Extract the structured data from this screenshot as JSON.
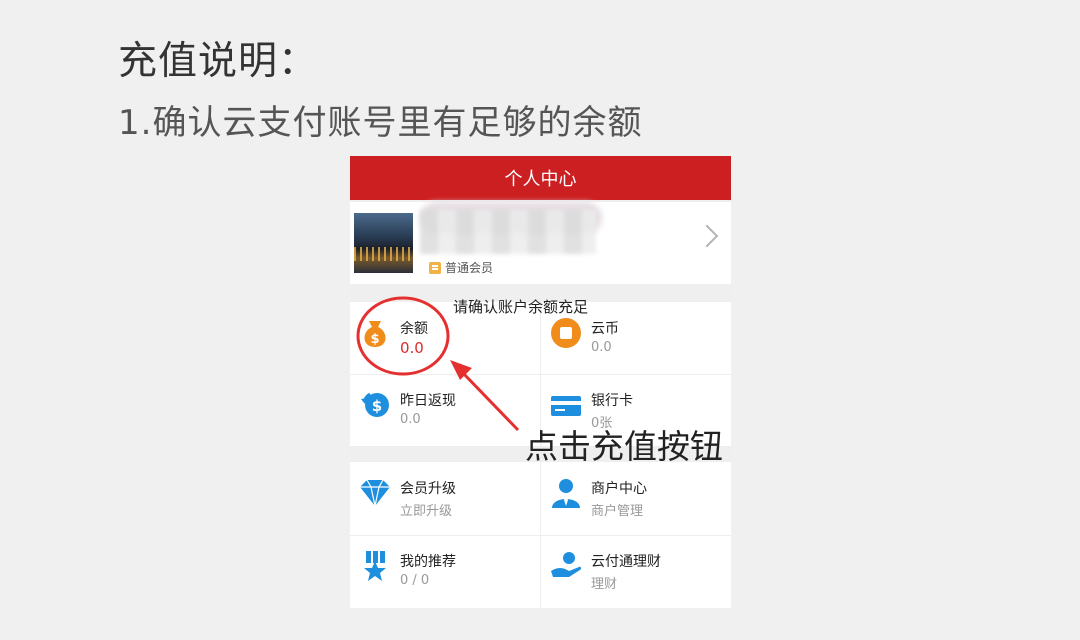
{
  "slide": {
    "heading": "充值说明：",
    "subheading": "1.确认云支付账号里有足够的余额"
  },
  "app": {
    "title": "个人中心",
    "profile": {
      "member_level": "普通会员"
    },
    "grid_top": [
      {
        "title": "余额",
        "value": "0.0",
        "icon": "money-bag-icon"
      },
      {
        "title": "云币",
        "value": "0.0",
        "icon": "coin-icon"
      },
      {
        "title": "昨日返现",
        "value": "0.0",
        "icon": "cashback-icon"
      },
      {
        "title": "银行卡",
        "value": "0张",
        "icon": "bank-card-icon"
      }
    ],
    "grid_bottom": [
      {
        "title": "会员升级",
        "value": "立即升级",
        "icon": "diamond-icon"
      },
      {
        "title": "商户中心",
        "value": "商户管理",
        "icon": "merchant-icon"
      },
      {
        "title": "我的推荐",
        "value": "0 / 0",
        "icon": "medal-icon"
      },
      {
        "title": "云付通理财",
        "value": "理财",
        "icon": "finance-icon"
      }
    ]
  },
  "annotations": {
    "confirm_note": "请确认账户余额充足",
    "click_note": "点击充值按钮"
  },
  "colors": {
    "header_red": "#cc1f22",
    "balance_red": "#e02a2a",
    "annotation_red": "#e53030",
    "icon_orange": "#f08c1a",
    "icon_blue": "#1e8fde"
  }
}
